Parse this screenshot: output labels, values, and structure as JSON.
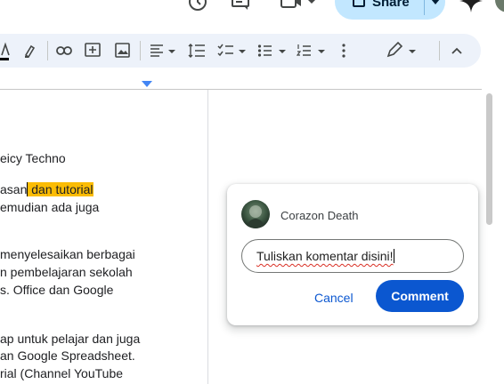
{
  "header": {
    "share_label": "Share",
    "icons": [
      "history-icon",
      "comments-icon",
      "meet-icon",
      "share-lock-icon",
      "gemini-spark-icon",
      "avatar"
    ]
  },
  "toolbar": {
    "items": [
      "text-color",
      "highlight-color",
      "insert-link",
      "add-comment",
      "insert-image",
      "align",
      "line-spacing",
      "checklist",
      "bulleted-list",
      "numbered-list",
      "more-options",
      "editing-mode",
      "hide-menus"
    ]
  },
  "document": {
    "lines": [
      {
        "before": "eicy Techno",
        "highlight": "",
        "after": ""
      },
      {
        "before": "asan",
        "highlight": " dan tutorial",
        "after": ""
      },
      {
        "before": "emudian ada juga",
        "highlight": "",
        "after": ""
      },
      {
        "before": " menyelesaikan berbagai",
        "highlight": "",
        "after": ""
      },
      {
        "before": "n pembelajaran sekolah",
        "highlight": "",
        "after": ""
      },
      {
        "before": "s. Office dan Google",
        "highlight": "",
        "after": ""
      },
      {
        "before": "ap untuk pelajar dan juga",
        "highlight": "",
        "after": ""
      },
      {
        "before": "an Google Spreadsheet.",
        "highlight": "",
        "after": ""
      },
      {
        "before": "rial (Channel YouTube",
        "highlight": "",
        "after": ""
      }
    ]
  },
  "comment": {
    "author": "Corazon Death",
    "input_value": "Tuliskan komentar disini!",
    "cancel_label": "Cancel",
    "submit_label": "Comment"
  },
  "colors": {
    "accent": "#0b57d0",
    "share_bg": "#c2e7ff",
    "toolbar_bg": "#edf2fa",
    "highlight": "#fbbc04"
  }
}
